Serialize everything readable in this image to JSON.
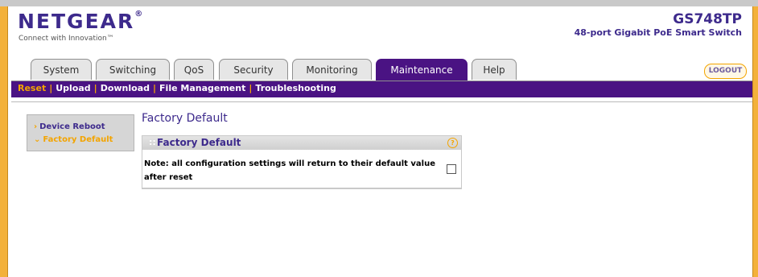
{
  "brand": {
    "logo_text": "NETGEAR",
    "logo_reg": "®",
    "tagline": "Connect with Innovation™",
    "model": "GS748TP",
    "model_desc": "48-port Gigabit PoE Smart Switch"
  },
  "tabs": [
    {
      "label": "System"
    },
    {
      "label": "Switching"
    },
    {
      "label": "QoS"
    },
    {
      "label": "Security"
    },
    {
      "label": "Monitoring"
    },
    {
      "label": "Maintenance",
      "active": true
    },
    {
      "label": "Help"
    }
  ],
  "logout_label": "LOGOUT",
  "subnav": {
    "items": [
      "Reset",
      "Upload",
      "Download",
      "File Management",
      "Troubleshooting"
    ],
    "active": "Reset",
    "separator": "|"
  },
  "sidebar": {
    "items": [
      {
        "label": "Device Reboot",
        "arrow": "›"
      },
      {
        "label": "Factory Default",
        "arrow": "⌄",
        "active": true
      }
    ]
  },
  "page": {
    "title": "Factory Default",
    "panel_title": "Factory Default",
    "panel_dots": "::",
    "help_icon": "?",
    "note": "Note: all configuration settings will return to their default value after reset",
    "checkbox_checked": false
  },
  "colors": {
    "brand_purple": "#4a1383",
    "accent_orange": "#f3a400",
    "frame_orange": "#f3b13a",
    "title_blue": "#3d2a8c"
  }
}
